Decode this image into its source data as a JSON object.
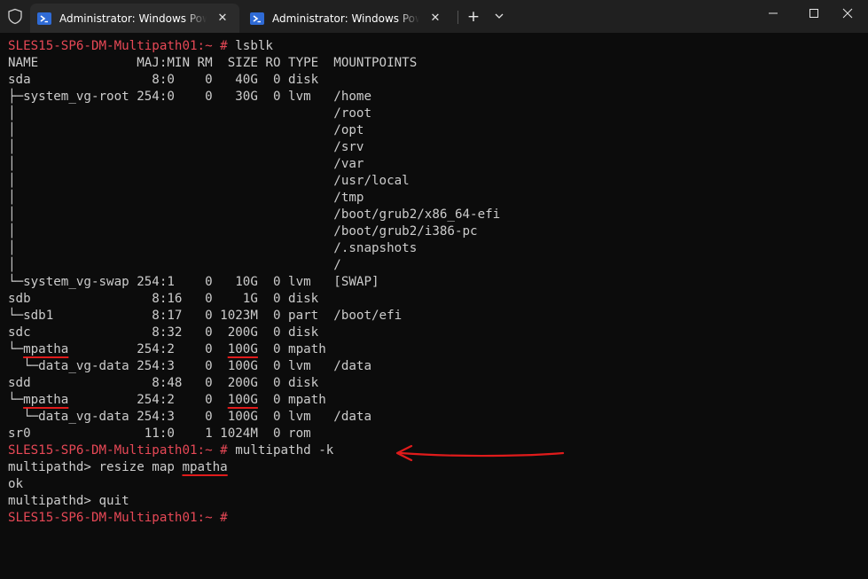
{
  "tabs": [
    {
      "title": "Administrator: Windows PowerShell",
      "close": "✕",
      "active": true
    },
    {
      "title": "Administrator: Windows PowerShell",
      "close": "✕",
      "active": false
    }
  ],
  "titlebar": {
    "new_tab": "+"
  },
  "terminal": {
    "lines": [
      [
        {
          "t": "SLES15-SP6-DM-Multipath01:~ #",
          "c": "prompt"
        },
        {
          "t": " lsblk"
        }
      ],
      [
        {
          "t": "NAME             MAJ:MIN RM  SIZE RO TYPE  MOUNTPOINTS"
        }
      ],
      [
        {
          "t": "sda                8:0    0   40G  0 disk"
        }
      ],
      [
        {
          "t": "├─system_vg-root 254:0    0   30G  0 lvm   /home"
        }
      ],
      [
        {
          "t": "│                                          /root"
        }
      ],
      [
        {
          "t": "│                                          /opt"
        }
      ],
      [
        {
          "t": "│                                          /srv"
        }
      ],
      [
        {
          "t": "│                                          /var"
        }
      ],
      [
        {
          "t": "│                                          /usr/local"
        }
      ],
      [
        {
          "t": "│                                          /tmp"
        }
      ],
      [
        {
          "t": "│                                          /boot/grub2/x86_64-efi"
        }
      ],
      [
        {
          "t": "│                                          /boot/grub2/i386-pc"
        }
      ],
      [
        {
          "t": "│                                          /.snapshots"
        }
      ],
      [
        {
          "t": "│                                          /"
        }
      ],
      [
        {
          "t": "└─system_vg-swap 254:1    0   10G  0 lvm   [SWAP]"
        }
      ],
      [
        {
          "t": "sdb                8:16   0    1G  0 disk"
        }
      ],
      [
        {
          "t": "└─sdb1             8:17   0 1023M  0 part  /boot/efi"
        }
      ],
      [
        {
          "t": "sdc                8:32   0  200G  0 disk"
        }
      ],
      [
        {
          "t": "└─"
        },
        {
          "t": "mpatha",
          "c": "ul"
        },
        {
          "t": "         254:2    0  "
        },
        {
          "t": "100G",
          "c": "ul"
        },
        {
          "t": "  0 mpath"
        }
      ],
      [
        {
          "t": "  └─data_vg-data 254:3    0  100G  0 lvm   /data"
        }
      ],
      [
        {
          "t": "sdd                8:48   0  200G  0 disk"
        }
      ],
      [
        {
          "t": "└─"
        },
        {
          "t": "mpatha",
          "c": "ul"
        },
        {
          "t": "         254:2    0  "
        },
        {
          "t": "100G",
          "c": "ul"
        },
        {
          "t": "  0 mpath"
        }
      ],
      [
        {
          "t": "  └─data_vg-data 254:3    0  100G  0 lvm   /data"
        }
      ],
      [
        {
          "t": "sr0               11:0    1 1024M  0 rom"
        }
      ],
      [
        {
          "t": "SLES15-SP6-DM-Multipath01:~ #",
          "c": "prompt"
        },
        {
          "t": " multipathd -k"
        }
      ],
      [
        {
          "t": "multipathd> resize map "
        },
        {
          "t": "mpatha",
          "c": "ul"
        }
      ],
      [
        {
          "t": "ok"
        }
      ],
      [
        {
          "t": "multipathd> quit"
        }
      ],
      [
        {
          "t": "SLES15-SP6-DM-Multipath01:~ #",
          "c": "prompt"
        }
      ]
    ]
  },
  "colors": {
    "prompt": "#e74856",
    "text": "#cccccc",
    "background": "#0c0c0c",
    "annotation": "#e01b1b"
  }
}
